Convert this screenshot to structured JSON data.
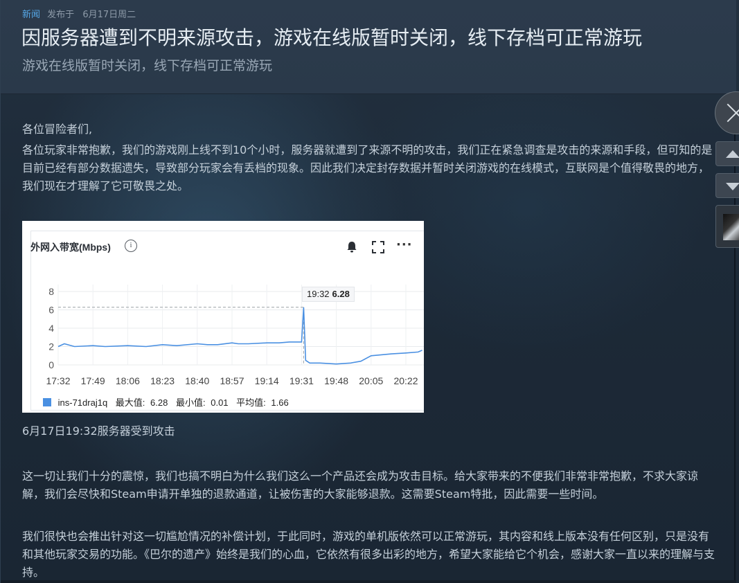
{
  "header": {
    "tag": "新闻",
    "published_label": "发布于",
    "date": "6月17日周二",
    "title": "因服务器遭到不明来源攻击，游戏在线版暂时关闭，线下存档可正常游玩",
    "subtitle": "游戏在线版暂时关闭，线下存档可正常游玩"
  },
  "article": {
    "greeting": "各位冒险者们,",
    "para1": "各位玩家非常抱歉，我们的游戏刚上线不到10个小时，服务器就遭到了来源不明的攻击，我们正在紧急调查是攻击的来源和手段，但可知的是目前已经有部分数据遗失，导致部分玩家会有丢档的现象。因此我们决定封存数据并暂时关闭游戏的在线模式，互联网是个值得敬畏的地方，我们现在才理解了它可敬畏之处。",
    "image_caption": "6月17日19:32服务器受到攻击",
    "para2": "这一切让我们十分的震惊，我们也搞不明白为什么我们这么一个产品还会成为攻击目标。给大家带来的不便我们非常非常抱歉，不求大家谅解，我们会尽快和Steam申请开单独的退款通道，让被伤害的大家能够退款。这需要Steam特批，因此需要一些时间。",
    "para3": "我们很快也会推出针对这一切尴尬情况的补偿计划，于此同时，游戏的单机版依然可以正常游玩，其内容和线上版本没有任何区别，只是没有和其他玩家交易的功能。《巴尔的遗产》始终是我们的心血，它依然有很多出彩的地方，希望大家能给它个机会，感谢大家一直以来的理解与支持。"
  },
  "chart_data": {
    "type": "line",
    "title": "外网入带宽(Mbps)",
    "x_ticks": [
      "17:32",
      "17:49",
      "18:06",
      "18:23",
      "18:40",
      "18:57",
      "19:14",
      "19:31",
      "19:48",
      "20:05",
      "20:22"
    ],
    "y_ticks": [
      0,
      2,
      4,
      6,
      8
    ],
    "ylim": [
      0,
      8
    ],
    "grid": true,
    "series": [
      {
        "name": "ins-71draj1q",
        "color": "#4a90e2",
        "x": [
          "17:32",
          "17:35",
          "17:40",
          "17:49",
          "17:55",
          "18:06",
          "18:15",
          "18:23",
          "18:30",
          "18:40",
          "18:45",
          "18:50",
          "18:57",
          "19:00",
          "19:05",
          "19:14",
          "19:20",
          "19:25",
          "19:31",
          "19:32",
          "19:33",
          "19:35",
          "19:40",
          "19:48",
          "19:55",
          "20:00",
          "20:05",
          "20:10",
          "20:15",
          "20:22",
          "20:28",
          "20:30"
        ],
        "values": [
          2.0,
          2.3,
          2.0,
          2.1,
          2.0,
          2.1,
          2.0,
          2.2,
          2.1,
          2.3,
          2.2,
          2.2,
          2.4,
          2.3,
          2.3,
          2.4,
          2.4,
          2.5,
          2.5,
          6.28,
          0.5,
          0.2,
          0.2,
          0.1,
          0.2,
          0.4,
          1.0,
          1.1,
          1.2,
          1.3,
          1.4,
          1.6
        ]
      }
    ],
    "tooltip": {
      "time": "19:32",
      "value": "6.28"
    },
    "legend": {
      "name": "ins-71draj1q",
      "max_label": "最大值:",
      "max": "6.28",
      "min_label": "最小值:",
      "min": "0.01",
      "avg_label": "平均值:",
      "avg": "1.66"
    },
    "info_symbol": "i",
    "more_symbol": "···"
  }
}
